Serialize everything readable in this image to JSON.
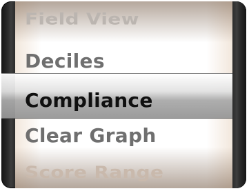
{
  "picker": {
    "items": [
      {
        "label": "Field View"
      },
      {
        "label": "Deciles"
      },
      {
        "label": "Compliance"
      },
      {
        "label": "Clear Graph"
      },
      {
        "label": "Score Range"
      }
    ],
    "selected_label": "Compliance"
  }
}
